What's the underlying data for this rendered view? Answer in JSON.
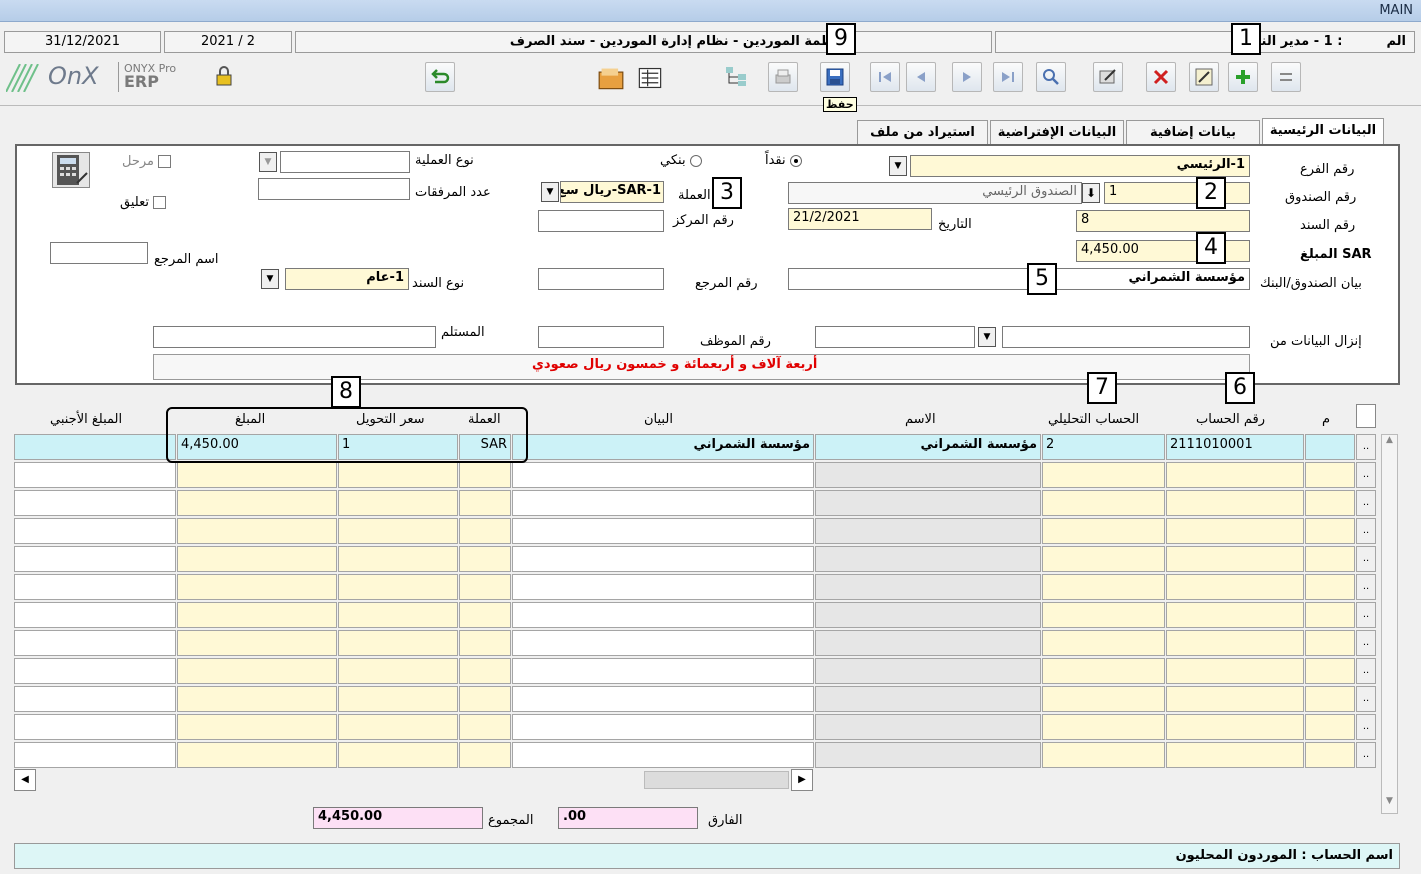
{
  "window": {
    "title": "MAIN"
  },
  "status": {
    "date": "31/12/2021",
    "period": "2021 / 2",
    "system_title": "أنظمة الموردين - نظام إدارة الموردين - سند الصرف",
    "user_prefix": "الم",
    "user": ": 1 - مدير النظام"
  },
  "logo": {
    "brand": "ONYX Pro",
    "product": "ERP"
  },
  "toolbar": {
    "save_tooltip": "حفظ"
  },
  "tabs": [
    "البيانات الرئيسية",
    "بيانات إضافية",
    "البيانات الإفتراضية",
    "استيراد من ملف"
  ],
  "form": {
    "branch_label": "رقم الفرع",
    "branch_value": "1-الرئيسي",
    "fund_label": "رقم الصندوق",
    "fund_no": "1",
    "fund_name": "الصندوق الرئيسي",
    "voucher_label": "رقم السند",
    "voucher_value": "8",
    "amount_label": "SAR المبلغ",
    "amount_value": "4,450.00",
    "bank_stmt_label": "بيان الصندوق/البنك",
    "bank_stmt_value": "مؤسسة الشمراني",
    "download_label": "إنزال البيانات من",
    "cash_label": "نقداً",
    "bank_label": "بنكي",
    "currency_label": "العملة",
    "currency_value": "1-SAR-ريال سع",
    "center_label": "رقم المركز",
    "date_label": "التاريخ",
    "date_value": "21/2/2021",
    "ref_label": "رقم المرجع",
    "employee_label": "رقم الموظف",
    "optype_label": "نوع العملية",
    "attach_label": "عدد المرفقات",
    "posted_label": "مرحل",
    "suspend_label": "تعليق",
    "refname_label": "اسم المرجع",
    "vtype_label": "نوع السند",
    "vtype_value": "1-عام",
    "receiver_label": "المستلم",
    "amount_words": "أربعة آلاف و أربعمائة و خمسون  ريال صعودي"
  },
  "grid": {
    "headers": {
      "m": "م",
      "account_no": "رقم الحساب",
      "analytic": "الحساب التحليلي",
      "name": "الاسم",
      "statement": "البيان",
      "currency": "العملة",
      "rate": "سعر التحويل",
      "amount": "المبلغ",
      "foreign": "المبلغ الأجنبي"
    },
    "rows": [
      {
        "account_no": "2111010001",
        "analytic": "2",
        "name": "مؤسسة الشمراني",
        "statement": "مؤسسة الشمراني",
        "currency": "SAR",
        "rate": "1",
        "amount": "4,450.00",
        "foreign": ""
      }
    ],
    "row_button": ".."
  },
  "footer": {
    "diff_label": "الفارق",
    "diff_value": ".00",
    "total_label": "المجموع",
    "total_value": "4,450.00",
    "account_name": "اسم الحساب : الموردون المحليون"
  },
  "callouts": [
    "1",
    "2",
    "3",
    "4",
    "5",
    "6",
    "7",
    "8",
    "9"
  ]
}
